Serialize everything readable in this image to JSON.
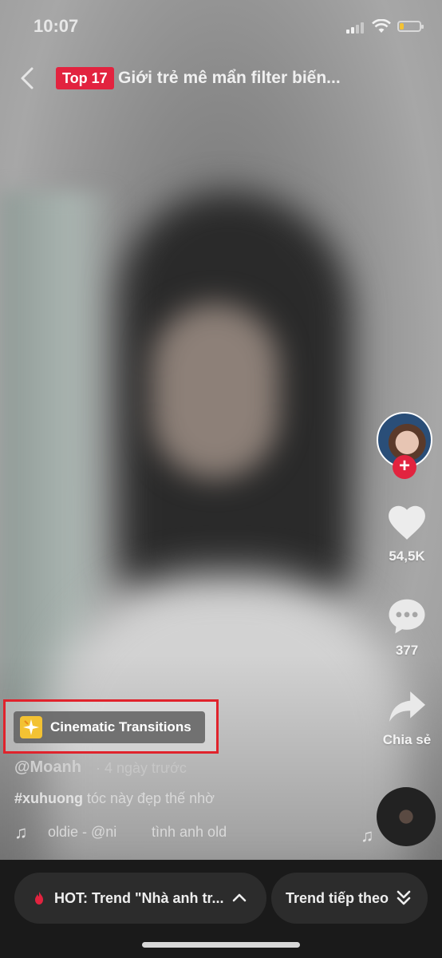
{
  "status_bar": {
    "time": "10:07",
    "battery_level": 0.2,
    "battery_color": "#f3c233"
  },
  "top_bar": {
    "back_icon": "chevron-left-icon",
    "badge": "Top 17",
    "badge_color": "#e2233f",
    "title": "Giới trẻ mê mẩn filter biến..."
  },
  "actions": {
    "follow_label": "+",
    "like_count": "54,5K",
    "comment_count": "377",
    "share_label": "Chia sẻ"
  },
  "effect": {
    "label": "Cinematic Transitions",
    "icon": "sparkle-icon",
    "highlight_color": "#e0232c"
  },
  "caption": {
    "username": "@Moanh",
    "time": "· 4 ngày trước",
    "hashtag": "#xuhuong",
    "text": " tóc này đẹp thế nhờ"
  },
  "music": {
    "icon": "music-note-icon",
    "text_a": "oldie - @ni",
    "text_b": "tình anh old"
  },
  "bottom_bar": {
    "hot_label": "HOT: Trend \"Nhà anh tr...",
    "hot_icon": "fire-icon",
    "next_label": "Trend tiếp theo",
    "next_icon": "double-chevron-down-icon"
  }
}
